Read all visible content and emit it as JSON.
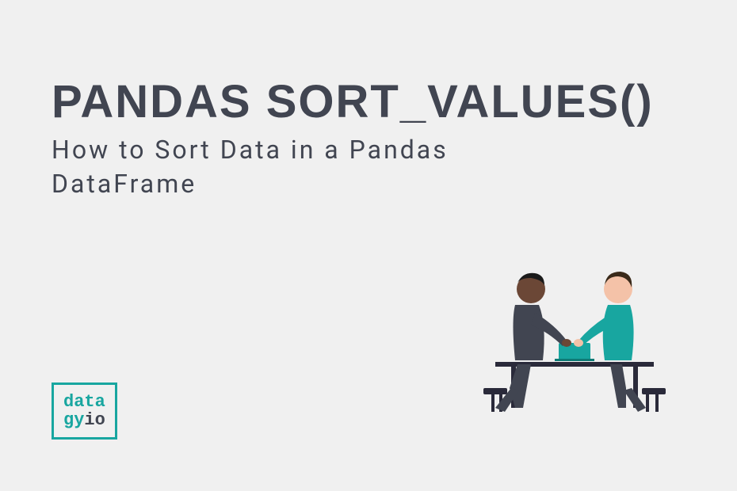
{
  "title": "PANDAS SORT_VALUES()",
  "subtitle": "How to Sort Data in a Pandas DataFrame",
  "logo": {
    "line1": "data",
    "line2_part1": "gy",
    "line2_part2": "io"
  }
}
